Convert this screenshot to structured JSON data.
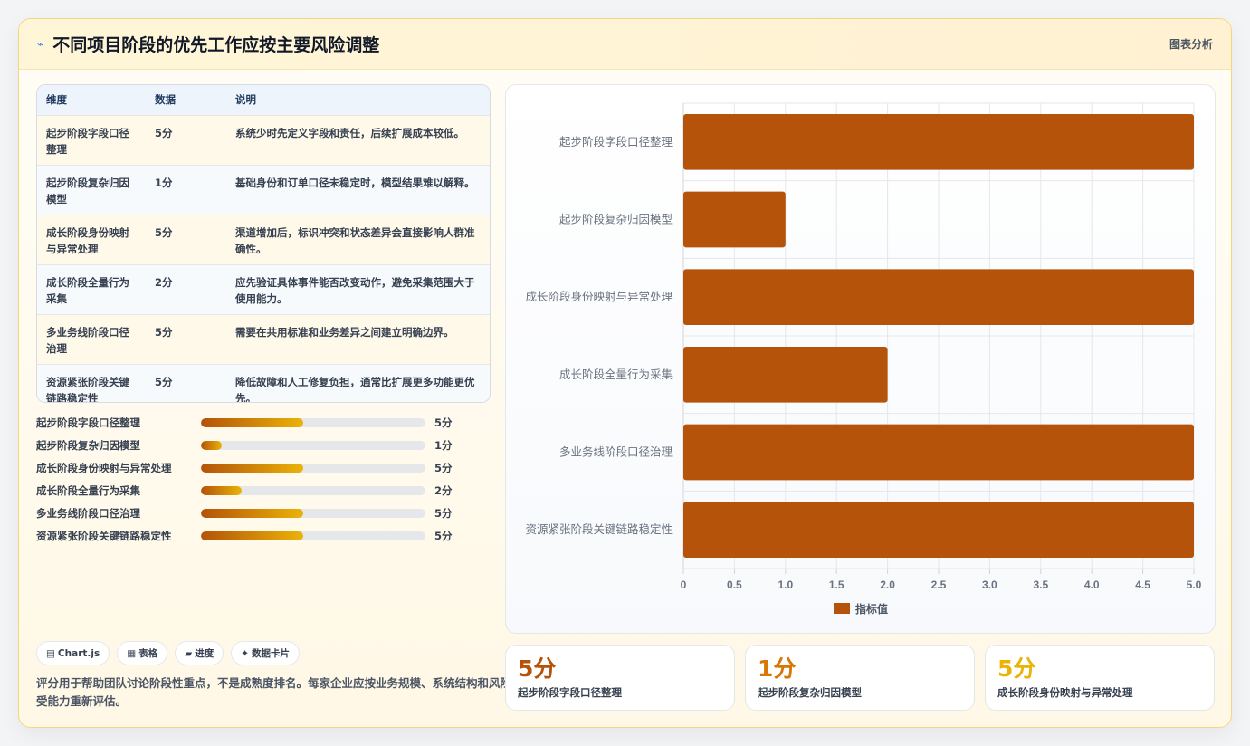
{
  "header": {
    "icon": "⌁",
    "title": "不同项目阶段的优先工作应按主要风险调整",
    "right_label": "图表分析"
  },
  "table": {
    "headers": [
      "维度",
      "数据",
      "说明"
    ],
    "rows": [
      {
        "dim": "起步阶段字段口径整理",
        "val": "5分",
        "desc": "系统少时先定义字段和责任，后续扩展成本较低。"
      },
      {
        "dim": "起步阶段复杂归因模型",
        "val": "1分",
        "desc": "基础身份和订单口径未稳定时，模型结果难以解释。"
      },
      {
        "dim": "成长阶段身份映射与异常处理",
        "val": "5分",
        "desc": "渠道增加后，标识冲突和状态差异会直接影响人群准确性。"
      },
      {
        "dim": "成长阶段全量行为采集",
        "val": "2分",
        "desc": "应先验证具体事件能否改变动作，避免采集范围大于使用能力。"
      },
      {
        "dim": "多业务线阶段口径治理",
        "val": "5分",
        "desc": "需要在共用标准和业务差异之间建立明确边界。"
      },
      {
        "dim": "资源紧张阶段关键链路稳定性",
        "val": "5分",
        "desc": "降低故障和人工修复负担，通常比扩展更多功能更优先。"
      }
    ]
  },
  "progress": {
    "max": 5,
    "items": [
      {
        "label": "起步阶段字段口径整理",
        "value": 5,
        "text": "5分"
      },
      {
        "label": "起步阶段复杂归因模型",
        "value": 1,
        "text": "1分"
      },
      {
        "label": "成长阶段身份映射与异常处理",
        "value": 5,
        "text": "5分"
      },
      {
        "label": "成长阶段全量行为采集",
        "value": 2,
        "text": "2分"
      },
      {
        "label": "多业务线阶段口径治理",
        "value": 5,
        "text": "5分"
      },
      {
        "label": "资源紧张阶段关键链路稳定性",
        "value": 5,
        "text": "5分"
      }
    ]
  },
  "tags": [
    {
      "icon": "▤",
      "label": "Chart.js"
    },
    {
      "icon": "▦",
      "label": "表格"
    },
    {
      "icon": "▰",
      "label": "进度"
    },
    {
      "icon": "✦",
      "label": "数据卡片"
    }
  ],
  "note": "评分用于帮助团队讨论阶段性重点，不是成熟度排名。每家企业应按业务规模、系统结构和风险承受能力重新评估。",
  "chart_data": {
    "type": "bar",
    "orientation": "horizontal",
    "categories": [
      "起步阶段字段口径整理",
      "起步阶段复杂归因模型",
      "成长阶段身份映射与异常处理",
      "成长阶段全量行为采集",
      "多业务线阶段口径治理",
      "资源紧张阶段关键链路稳定性"
    ],
    "series": [
      {
        "name": "指标值",
        "values": [
          5,
          1,
          5,
          2,
          5,
          5
        ],
        "color": "#b45309"
      }
    ],
    "xlim": [
      0,
      5
    ],
    "xticks": [
      "0",
      "0.5",
      "1.0",
      "1.5",
      "2.0",
      "2.5",
      "3.0",
      "3.5",
      "4.0",
      "4.5",
      "5.0"
    ],
    "grid": true,
    "legend": "bottom"
  },
  "stats": [
    {
      "value": "5分",
      "label": "起步阶段字段口径整理",
      "color": "#b45309"
    },
    {
      "value": "1分",
      "label": "起步阶段复杂归因模型",
      "color": "#d97706"
    },
    {
      "value": "5分",
      "label": "成长阶段身份映射与异常处理",
      "color": "#eab308"
    }
  ]
}
